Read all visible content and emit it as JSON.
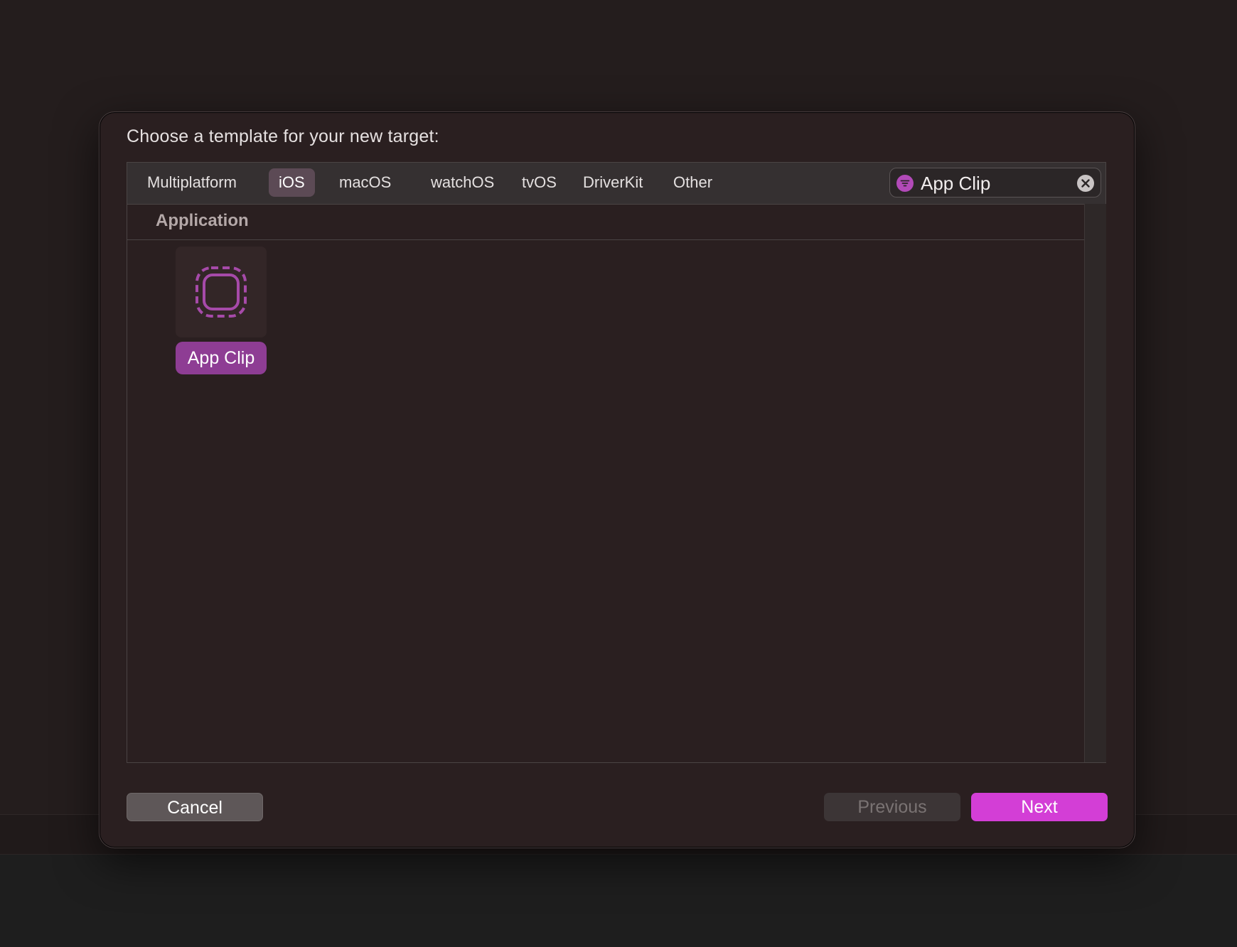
{
  "dialog": {
    "title": "Choose a template for your new target:"
  },
  "platform_tabs": [
    {
      "label": "Multiplatform",
      "selected": false
    },
    {
      "label": "iOS",
      "selected": true
    },
    {
      "label": "macOS",
      "selected": false
    },
    {
      "label": "watchOS",
      "selected": false
    },
    {
      "label": "tvOS",
      "selected": false
    },
    {
      "label": "DriverKit",
      "selected": false
    },
    {
      "label": "Other",
      "selected": false
    }
  ],
  "search": {
    "value": "App Clip",
    "filter_icon": "filter-icon",
    "clear_icon": "clear-icon"
  },
  "section": {
    "label": "Application"
  },
  "templates": [
    {
      "label": "App Clip",
      "icon": "app-clip-icon",
      "selected": true
    }
  ],
  "buttons": {
    "cancel": "Cancel",
    "previous": "Previous",
    "next": "Next"
  },
  "colors": {
    "accent": "#d33ed6",
    "selection": "#8e3d94",
    "selected_tab": "#5c4a55"
  }
}
